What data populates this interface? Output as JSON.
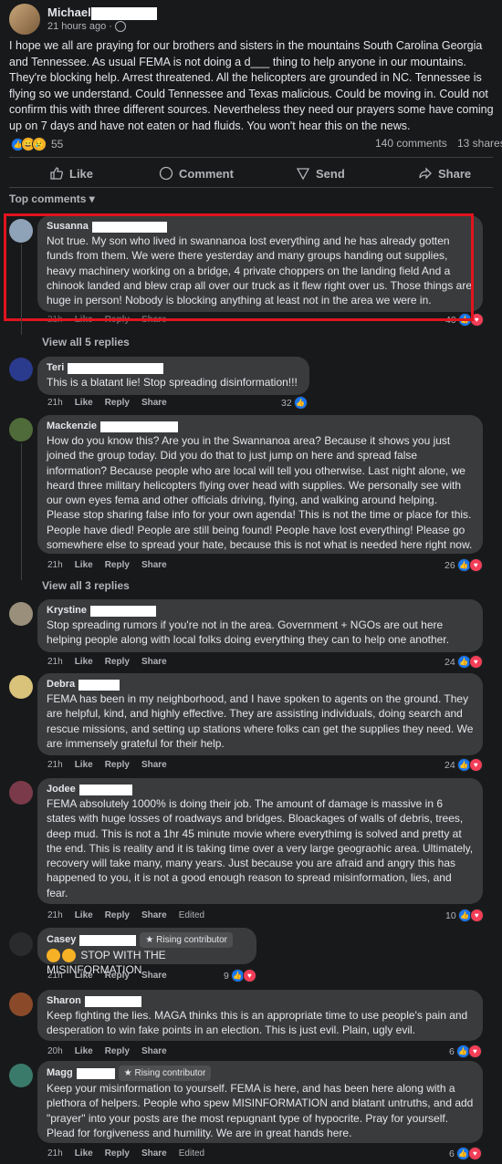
{
  "post": {
    "author": "Michael",
    "time": "21 hours ago",
    "separator": "·",
    "body": "I hope we all are praying for our brothers and sisters in the mountains South Carolina Georgia and Tennessee. As usual FEMA is not doing a d___ thing to help anyone in our mountains. They're blocking help. Arrest threatened. All the helicopters are grounded in NC. Tennessee is flying so we understand. Could Tennessee and Texas malicious. Could be moving in. Could not confirm this with three different sources. Nevertheless they need our prayers some have coming up on 7 days and have not eaten or had fluids. You won't hear this on the news.",
    "reaction_count": "55",
    "comments_count": "140 comments",
    "shares_count": "13 shares",
    "actions": {
      "like": "Like",
      "comment": "Comment",
      "send": "Send",
      "share": "Share"
    }
  },
  "sort_label": "Top comments",
  "comment_actions": {
    "like": "Like",
    "reply": "Reply",
    "share": "Share",
    "edited": "Edited"
  },
  "comments": [
    {
      "name": "Susanna",
      "text": "Not true. My son who lived in swannanoa lost everything and he has already gotten funds from them. We were there yesterday and many groups handing out supplies, heavy machinery working on a bridge, 4 private choppers on the landing field And a chinook landed and blew crap all over our truck as it flew right over us. Those things are huge in person! Nobody is blocking anything at least not in the area we were in.",
      "time": "21h",
      "reactions": "40",
      "view_replies": "View all 5 replies"
    },
    {
      "name": "Teri",
      "text": "This is a blatant lie! Stop spreading disinformation!!!",
      "time": "21h",
      "reactions": "32"
    },
    {
      "name": "Mackenzie",
      "text": "How do you know this? Are you in the Swannanoa area? Because it shows you just joined the group today. Did you do that to just jump on here and spread false information? Because people who are local will tell you otherwise. Last night alone, we heard three military helicopters flying over head with supplies. We personally see with our own eyes fema and other officials driving, flying, and walking around helping. Please stop sharing false info for your own agenda! This is not the time or place for this. People have died! People are still being found! People have lost everything! Please go somewhere else to spread your hate, because this is not what is needed here right now.",
      "time": "21h",
      "reactions": "26",
      "view_replies": "View all 3 replies"
    },
    {
      "name": "Krystine",
      "text": "Stop spreading rumors if you're not in the area. Government + NGOs are out here helping people along with local folks doing everything they can to help one another.",
      "time": "21h",
      "reactions": "24"
    },
    {
      "name": "Debra",
      "text": "FEMA has been in my neighborhood, and I have spoken to agents on the ground. They are helpful, kind, and highly effective. They are assisting individuals, doing search and rescue missions, and setting up stations where folks can get the supplies they need. We are immensely grateful for their help.",
      "time": "21h",
      "reactions": "24"
    },
    {
      "name": "Jodee",
      "text": "FEMA absolutely 1000% is doing their job. The amount of damage is massive in 6 states with huge losses of roadways and bridges. Bloackages of walls of debris, trees, deep mud. This is not a 1hr 45 minute movie where everythimg is solved and pretty at the end. This is reality and it is taking time over a very large geograohic area. Ultimately, recovery will take many, many years. Just because you are afraid and angry this has happened to you, it is not a good enough reason to spread misinformation, lies, and fear.",
      "time": "21h",
      "reactions": "10",
      "edited": true
    },
    {
      "name": "Casey",
      "badge": "Rising contributor",
      "text": "STOP WITH THE MISINFORMATION",
      "time": "21h",
      "reactions": "9"
    },
    {
      "name": "Sharon",
      "text": "Keep fighting the lies. MAGA thinks this is an appropriate time to use people's pain and desperation to win fake points in an election. This is just evil. Plain, ugly evil.",
      "time": "20h",
      "reactions": "6"
    },
    {
      "name": "Magg",
      "badge": "Rising contributor",
      "text": "Keep your misinformation to yourself. FEMA is here, and has been here along with a plethora of helpers. People who spew MISINFORMATION and blatant untruths, and add \"prayer\" into your posts are the most repugnant type of hypocrite. Pray for yourself. Plead for forgiveness and humility. We are in great hands here.",
      "time": "21h",
      "reactions": "6",
      "edited": true
    }
  ]
}
